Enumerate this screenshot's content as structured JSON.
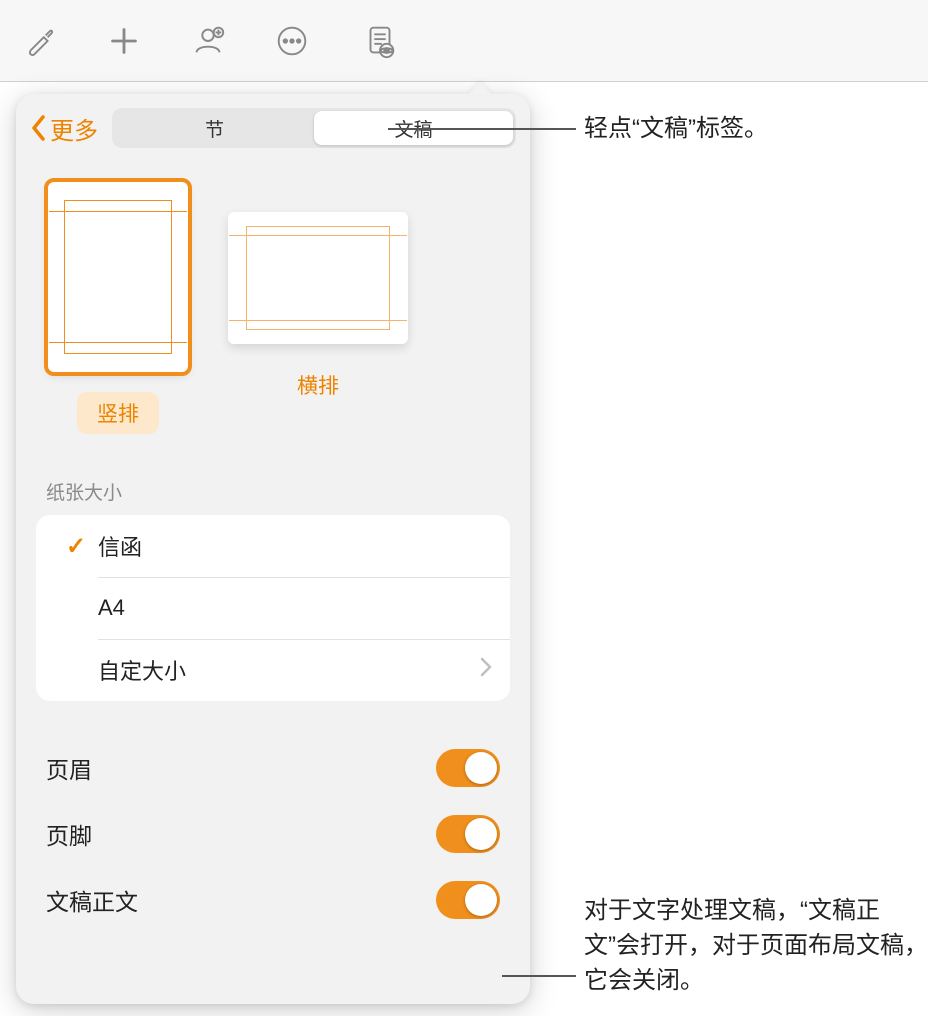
{
  "toolbar": {
    "icons": [
      "brush-icon",
      "plus-icon",
      "collaborate-icon",
      "more-icon",
      "document-view-icon"
    ]
  },
  "panel": {
    "back_label": "更多",
    "tabs": {
      "section": "节",
      "document": "文稿"
    },
    "orientation": {
      "portrait": "竖排",
      "landscape": "横排"
    },
    "paper_size": {
      "label": "纸张大小",
      "options": [
        "信函",
        "A4",
        "自定大小"
      ],
      "selected_index": 0
    },
    "toggles": {
      "header": "页眉",
      "footer": "页脚",
      "body": "文稿正文"
    }
  },
  "callouts": {
    "tap_document_tab": "轻点“文稿”标签。",
    "body_toggle_note": "对于文字处理文稿，“文稿正文”会打开，对于页面布局文稿，它会关闭。"
  }
}
